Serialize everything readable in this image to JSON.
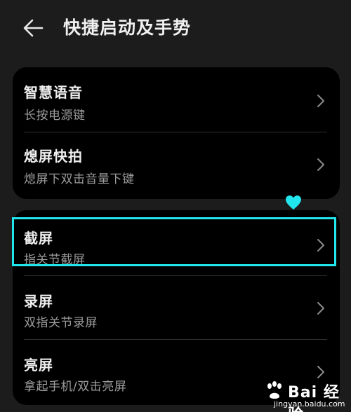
{
  "header": {
    "title": "快捷启动及手势",
    "back_icon": "arrow-left-icon"
  },
  "group1": {
    "items": [
      {
        "title": "智慧语音",
        "subtitle": "长按电源键"
      },
      {
        "title": "熄屏快拍",
        "subtitle": "熄屏下双击音量下键"
      }
    ]
  },
  "group2": {
    "items": [
      {
        "title": "截屏",
        "subtitle": "指关节截屏"
      },
      {
        "title": "录屏",
        "subtitle": "双指关节录屏"
      },
      {
        "title": "亮屏",
        "subtitle": "拿起手机/双击亮屏"
      }
    ]
  },
  "annotation": {
    "highlight_color": "#22e6ee",
    "heart_icon": "heart-icon"
  },
  "watermark": {
    "brand": "Bai 经验",
    "url": "jingyan.baidu.com"
  },
  "colors": {
    "background": "#1c1c1c",
    "card": "#000000",
    "primary_text": "#efefef",
    "secondary_text": "#9c9c9c"
  }
}
